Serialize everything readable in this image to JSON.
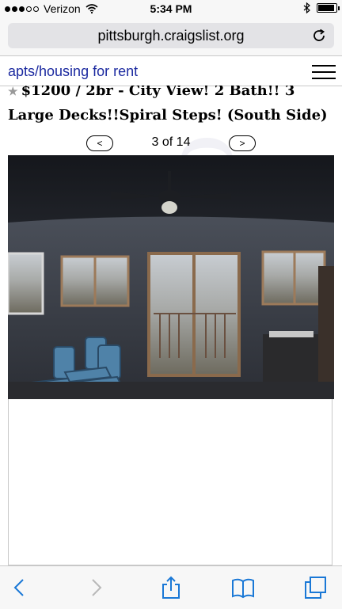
{
  "status_bar": {
    "carrier": "Verizon",
    "time": "5:34 PM"
  },
  "browser": {
    "url": "pittsburgh.craigslist.org"
  },
  "header": {
    "section_link": "apts/housing for rent"
  },
  "post": {
    "title": "$1200 / 2br - City View! 2 Bath!! 3 Large Decks!!Spiral Steps! (South Side)",
    "star_glyph": "★"
  },
  "pager": {
    "prev_label": "<",
    "next_label": ">",
    "count": "3 of 14"
  },
  "watermark": "craigslist",
  "toolbar": {
    "icons": [
      "back-icon",
      "forward-icon",
      "share-icon",
      "bookmarks-icon",
      "tabs-icon"
    ]
  },
  "colors": {
    "link": "#1c2aa0",
    "toolbar_icon": "#1a78d6",
    "toolbar_disabled": "#b8b8b8"
  }
}
